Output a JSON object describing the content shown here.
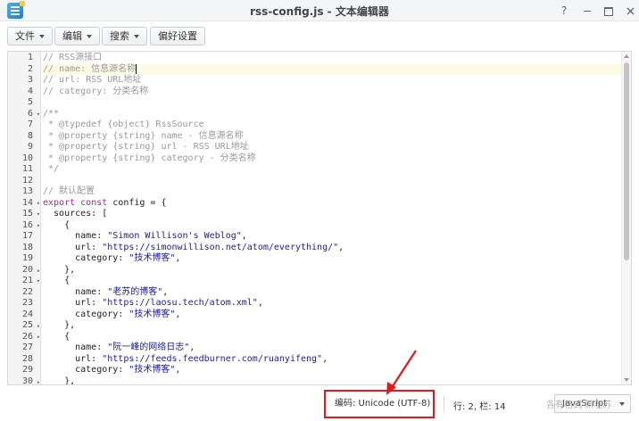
{
  "window": {
    "title": "rss-config.js - 文本编辑器",
    "help_glyph": "?"
  },
  "toolbar": {
    "file_label": "文件",
    "edit_label": "编辑",
    "search_label": "搜索",
    "prefs_label": "偏好设置"
  },
  "editor": {
    "active_line": 2,
    "lines": [
      {
        "n": "1",
        "fold": "",
        "tokens": [
          {
            "t": "// RSS源接口",
            "c": "com"
          }
        ]
      },
      {
        "n": "2",
        "fold": "",
        "tokens": [
          {
            "t": "// name: 信息源名称",
            "c": "com"
          }
        ]
      },
      {
        "n": "3",
        "fold": "",
        "tokens": [
          {
            "t": "// url: RSS URL地址",
            "c": "com"
          }
        ]
      },
      {
        "n": "4",
        "fold": "",
        "tokens": [
          {
            "t": "// category: 分类名称",
            "c": "com"
          }
        ]
      },
      {
        "n": "5",
        "fold": "",
        "tokens": []
      },
      {
        "n": "6",
        "fold": "▾",
        "tokens": [
          {
            "t": "/**",
            "c": "com"
          }
        ]
      },
      {
        "n": "7",
        "fold": "",
        "tokens": [
          {
            "t": " * @typedef {object} RssSource",
            "c": "com"
          }
        ]
      },
      {
        "n": "8",
        "fold": "",
        "tokens": [
          {
            "t": " * @property {string} name - 信息源名称",
            "c": "com"
          }
        ]
      },
      {
        "n": "9",
        "fold": "",
        "tokens": [
          {
            "t": " * @property {string} url - RSS URL地址",
            "c": "com"
          }
        ]
      },
      {
        "n": "10",
        "fold": "",
        "tokens": [
          {
            "t": " * @property {string} category - 分类名称",
            "c": "com"
          }
        ]
      },
      {
        "n": "11",
        "fold": "",
        "tokens": [
          {
            "t": " */",
            "c": "com"
          }
        ]
      },
      {
        "n": "12",
        "fold": "",
        "tokens": []
      },
      {
        "n": "13",
        "fold": "",
        "tokens": [
          {
            "t": "// 默认配置",
            "c": "com"
          }
        ]
      },
      {
        "n": "14",
        "fold": "▾",
        "tokens": [
          {
            "t": "export",
            "c": "kw"
          },
          {
            "t": " ",
            "c": "plain"
          },
          {
            "t": "const",
            "c": "kw"
          },
          {
            "t": " config = {",
            "c": "plain"
          }
        ]
      },
      {
        "n": "15",
        "fold": "▾",
        "tokens": [
          {
            "t": "  sources: [",
            "c": "plain"
          }
        ]
      },
      {
        "n": "16",
        "fold": "▾",
        "tokens": [
          {
            "t": "    {",
            "c": "plain"
          }
        ]
      },
      {
        "n": "17",
        "fold": "",
        "tokens": [
          {
            "t": "      name: ",
            "c": "plain"
          },
          {
            "t": "\"Simon Willison's Weblog\"",
            "c": "str"
          },
          {
            "t": ",",
            "c": "plain"
          }
        ]
      },
      {
        "n": "18",
        "fold": "",
        "tokens": [
          {
            "t": "      url: ",
            "c": "plain"
          },
          {
            "t": "\"https://simonwillison.net/atom/everything/\"",
            "c": "str"
          },
          {
            "t": ",",
            "c": "plain"
          }
        ]
      },
      {
        "n": "19",
        "fold": "",
        "tokens": [
          {
            "t": "      category: ",
            "c": "plain"
          },
          {
            "t": "\"技术博客\"",
            "c": "str"
          },
          {
            "t": ",",
            "c": "plain"
          }
        ]
      },
      {
        "n": "20",
        "fold": "▴",
        "tokens": [
          {
            "t": "    },",
            "c": "plain"
          }
        ]
      },
      {
        "n": "21",
        "fold": "▾",
        "tokens": [
          {
            "t": "    {",
            "c": "plain"
          }
        ]
      },
      {
        "n": "22",
        "fold": "",
        "tokens": [
          {
            "t": "      name: ",
            "c": "plain"
          },
          {
            "t": "\"老苏的博客\"",
            "c": "str"
          },
          {
            "t": ",",
            "c": "plain"
          }
        ]
      },
      {
        "n": "23",
        "fold": "",
        "tokens": [
          {
            "t": "      url: ",
            "c": "plain"
          },
          {
            "t": "\"https://laosu.tech/atom.xml\"",
            "c": "str"
          },
          {
            "t": ",",
            "c": "plain"
          }
        ]
      },
      {
        "n": "24",
        "fold": "",
        "tokens": [
          {
            "t": "      category: ",
            "c": "plain"
          },
          {
            "t": "\"技术博客\"",
            "c": "str"
          },
          {
            "t": ",",
            "c": "plain"
          }
        ]
      },
      {
        "n": "25",
        "fold": "▴",
        "tokens": [
          {
            "t": "    },",
            "c": "plain"
          }
        ]
      },
      {
        "n": "26",
        "fold": "▾",
        "tokens": [
          {
            "t": "    {",
            "c": "plain"
          }
        ]
      },
      {
        "n": "27",
        "fold": "",
        "tokens": [
          {
            "t": "      name: ",
            "c": "plain"
          },
          {
            "t": "\"阮一峰的网络日志\"",
            "c": "str"
          },
          {
            "t": ",",
            "c": "plain"
          }
        ]
      },
      {
        "n": "28",
        "fold": "",
        "tokens": [
          {
            "t": "      url: ",
            "c": "plain"
          },
          {
            "t": "\"https://feeds.feedburner.com/ruanyifeng\"",
            "c": "str"
          },
          {
            "t": ",",
            "c": "plain"
          }
        ]
      },
      {
        "n": "29",
        "fold": "",
        "tokens": [
          {
            "t": "      category: ",
            "c": "plain"
          },
          {
            "t": "\"技术博客\"",
            "c": "str"
          },
          {
            "t": ",",
            "c": "plain"
          }
        ]
      },
      {
        "n": "30",
        "fold": "▴",
        "tokens": [
          {
            "t": "    },",
            "c": "plain"
          }
        ]
      }
    ]
  },
  "statusbar": {
    "encoding": "编码: Unicode (UTF-8)",
    "position": "行: 2, 栏: 14",
    "language": "JavaScript",
    "watermark": "各有格式 新老苏"
  },
  "colors": {
    "highlight_box": "#e0191c",
    "comment": "#999999",
    "keyword": "#a3259e",
    "string": "#1a1aa6"
  }
}
